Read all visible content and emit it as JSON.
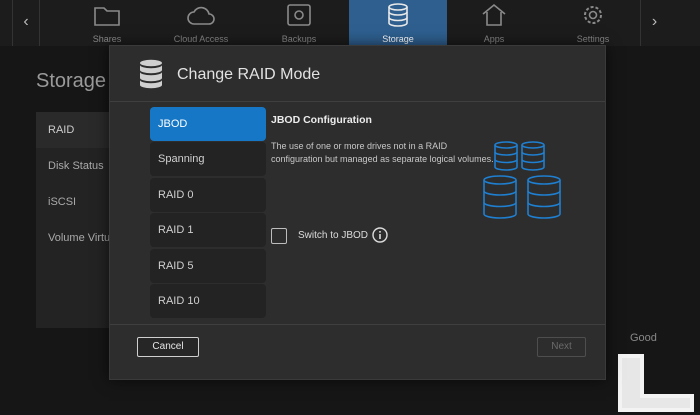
{
  "nav": {
    "tabs": [
      {
        "label": "Shares",
        "icon": "folder-icon",
        "active": false
      },
      {
        "label": "Cloud Access",
        "icon": "cloud-icon",
        "active": false
      },
      {
        "label": "Backups",
        "icon": "safe-icon",
        "active": false
      },
      {
        "label": "Storage",
        "icon": "database-icon",
        "active": true
      },
      {
        "label": "Apps",
        "icon": "apps-icon",
        "active": false
      },
      {
        "label": "Settings",
        "icon": "gear-icon",
        "active": false
      }
    ],
    "prev_glyph": "‹",
    "next_glyph": "›"
  },
  "page": {
    "title": "Storage",
    "sidebar": [
      {
        "label": "RAID",
        "active": true
      },
      {
        "label": "Disk Status",
        "active": false
      },
      {
        "label": "iSCSI",
        "active": false
      },
      {
        "label": "Volume Virtu",
        "active": false
      }
    ],
    "status": "Good"
  },
  "modal": {
    "title": "Change RAID Mode",
    "modes": [
      {
        "label": "JBOD",
        "selected": true
      },
      {
        "label": "Spanning",
        "selected": false
      },
      {
        "label": "RAID 0",
        "selected": false
      },
      {
        "label": "RAID 1",
        "selected": false
      },
      {
        "label": "RAID 5",
        "selected": false
      },
      {
        "label": "RAID 10",
        "selected": false
      }
    ],
    "config_title": "JBOD Configuration",
    "config_desc": "The use of one or more drives not in a RAID configuration but managed as separate logical volumes.",
    "switch_label": "Switch to JBOD",
    "switch_checked": false,
    "cancel_label": "Cancel",
    "next_label": "Next",
    "next_enabled": false
  },
  "colors": {
    "accent": "#1677c6",
    "active_tab": "#2e5f8f",
    "modal_bg": "#2d2d2d",
    "illustration": "#1f7fd0"
  }
}
